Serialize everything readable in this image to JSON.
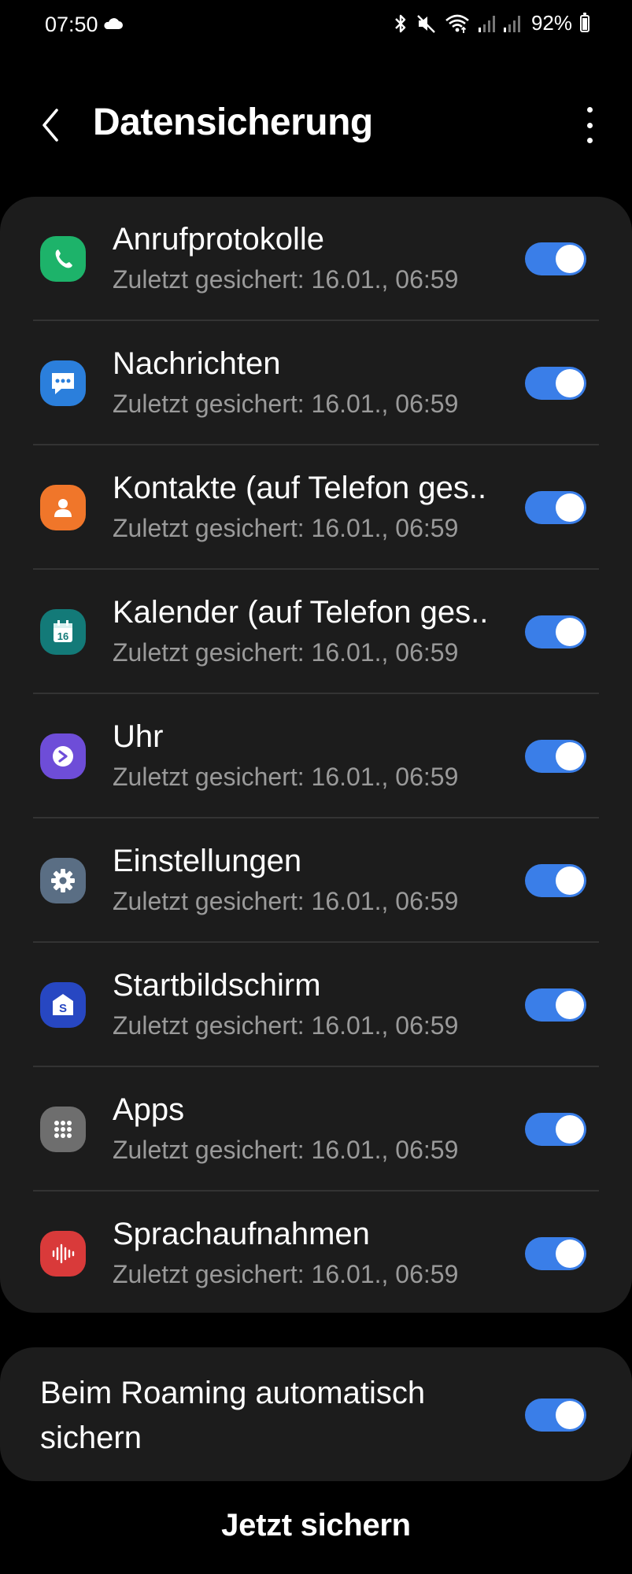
{
  "status_bar": {
    "time": "07:50",
    "battery": "92%",
    "icons": [
      "cloud-icon",
      "bluetooth-icon",
      "mute-icon",
      "wifi-icon",
      "signal-icon",
      "signal-icon",
      "battery-icon"
    ]
  },
  "header": {
    "title": "Datensicherung",
    "back_icon": "chevron-left-icon",
    "more_icon": "more-vertical-icon"
  },
  "items": [
    {
      "label": "Anrufprotokolle",
      "sub": "Zuletzt gesichert: 16.01., 06:59",
      "icon": "phone-icon",
      "color": "#1db36a",
      "enabled": true
    },
    {
      "label": "Nachrichten",
      "sub": "Zuletzt gesichert: 16.01., 06:59",
      "icon": "message-icon",
      "color": "#2b7fdc",
      "enabled": true
    },
    {
      "label": "Kontakte (auf Telefon ges..",
      "sub": "Zuletzt gesichert: 16.01., 06:59",
      "icon": "contact-icon",
      "color": "#f0762a",
      "enabled": true
    },
    {
      "label": "Kalender (auf Telefon ges..",
      "sub": "Zuletzt gesichert: 16.01., 06:59",
      "icon": "calendar-icon",
      "color": "#137a78",
      "enabled": true
    },
    {
      "label": "Uhr",
      "sub": "Zuletzt gesichert: 16.01., 06:59",
      "icon": "clock-icon",
      "color": "#6e4dd8",
      "enabled": true
    },
    {
      "label": "Einstellungen",
      "sub": "Zuletzt gesichert: 16.01., 06:59",
      "icon": "gear-icon",
      "color": "#5a6e84",
      "enabled": true
    },
    {
      "label": "Startbildschirm",
      "sub": "Zuletzt gesichert: 16.01., 06:59",
      "icon": "home-screen-icon",
      "color": "#2747c2",
      "enabled": true
    },
    {
      "label": "Apps",
      "sub": "Zuletzt gesichert: 16.01., 06:59",
      "icon": "apps-grid-icon",
      "color": "#6e6e6e",
      "enabled": true
    },
    {
      "label": "Sprachaufnahmen",
      "sub": "Zuletzt gesichert: 16.01., 06:59",
      "icon": "voice-recorder-icon",
      "color": "#d93a3a",
      "enabled": true
    }
  ],
  "roaming": {
    "label": "Beim Roaming automatisch sichern",
    "enabled": true
  },
  "action": {
    "label": "Jetzt sichern"
  },
  "colors": {
    "toggle_on": "#3a7ee8",
    "card": "#1c1c1c",
    "background": "#000000",
    "subtext": "#9a9a9a"
  }
}
